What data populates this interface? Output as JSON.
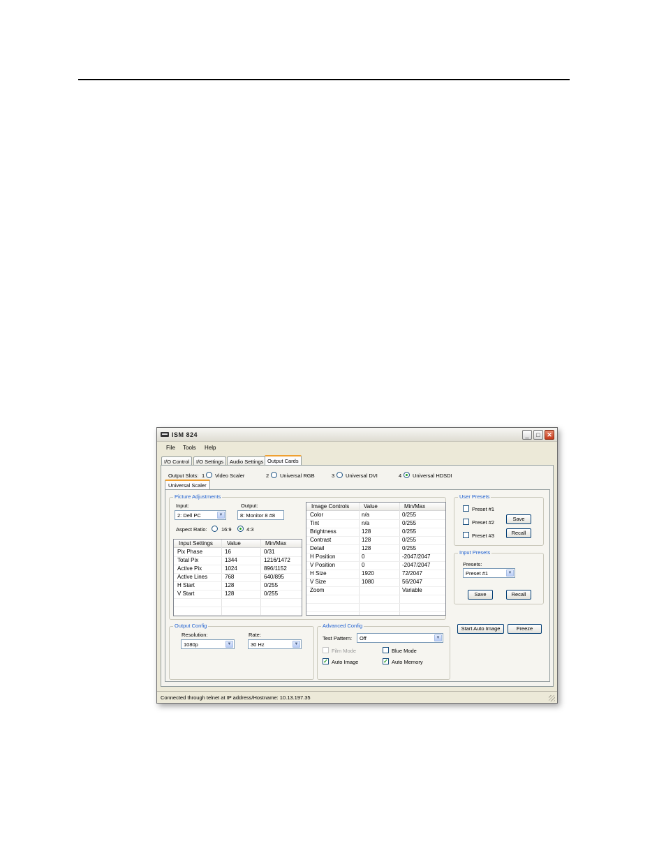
{
  "window": {
    "title": "ISM 824"
  },
  "menu": [
    "File",
    "Tools",
    "Help"
  ],
  "tabs": [
    "I/O Control",
    "I/O Settings",
    "Audio Settings",
    "Output Cards"
  ],
  "output_slots": {
    "label": "Output Slots:",
    "slots": [
      {
        "num": "1",
        "name": "Video Scaler",
        "selected": false
      },
      {
        "num": "2",
        "name": "Universal RGB",
        "selected": false
      },
      {
        "num": "3",
        "name": "Universal DVI",
        "selected": false
      },
      {
        "num": "4",
        "name": "Universal HDSDI",
        "selected": true
      }
    ]
  },
  "subtab": "Universal Scaler",
  "picture_adjustments": {
    "title": "Picture Adjustments",
    "input_label": "Input:",
    "input_value": "2: Dell PC",
    "output_label": "Output:",
    "output_value": "8: Monitor 8 #8",
    "aspect_label": "Aspect Ratio:",
    "aspect_16_9": "16:9",
    "aspect_4_3": "4:3",
    "aspect_selected": "4:3",
    "input_settings": {
      "headers": [
        "Input Settings",
        "Value",
        "Min/Max"
      ],
      "rows": [
        [
          "Pix Phase",
          "16",
          "0/31"
        ],
        [
          "Total Pix",
          "1344",
          "1216/1472"
        ],
        [
          "Active Pix",
          "1024",
          "896/1152"
        ],
        [
          "Active Lines",
          "768",
          "640/895"
        ],
        [
          "H Start",
          "128",
          "0/255"
        ],
        [
          "V Start",
          "128",
          "0/255"
        ]
      ]
    },
    "image_controls": {
      "headers": [
        "Image Controls",
        "Value",
        "Min/Max"
      ],
      "rows": [
        [
          "Color",
          "n/a",
          "0/255"
        ],
        [
          "Tint",
          "n/a",
          "0/255"
        ],
        [
          "Brightness",
          "128",
          "0/255"
        ],
        [
          "Contrast",
          "128",
          "0/255"
        ],
        [
          "Detail",
          "128",
          "0/255"
        ],
        [
          "H Position",
          "0",
          "-2047/2047"
        ],
        [
          "V Position",
          "0",
          "-2047/2047"
        ],
        [
          "H Size",
          "1920",
          "72/2047"
        ],
        [
          "V Size",
          "1080",
          "56/2047"
        ],
        [
          "Zoom",
          "",
          "Variable"
        ]
      ]
    }
  },
  "user_presets": {
    "title": "User Presets",
    "items": [
      "Preset #1",
      "Preset #2",
      "Preset #3"
    ],
    "save": "Save",
    "recall": "Recall"
  },
  "input_presets": {
    "title": "Input Presets",
    "presets_label": "Presets:",
    "presets_value": "Preset #1",
    "save": "Save",
    "recall": "Recall"
  },
  "buttons": {
    "start_auto_image": "Start Auto Image",
    "freeze": "Freeze"
  },
  "output_config": {
    "title": "Output Config",
    "resolution_label": "Resolution:",
    "resolution_value": "1080p",
    "rate_label": "Rate:",
    "rate_value": "30 Hz"
  },
  "advanced_config": {
    "title": "Advanced Config",
    "test_pattern_label": "Test Pattern:",
    "test_pattern_value": "Off",
    "film_mode": {
      "label": "Film Mode",
      "checked": false,
      "enabled": false
    },
    "blue_mode": {
      "label": "Blue Mode",
      "checked": false,
      "enabled": true
    },
    "auto_image": {
      "label": "Auto Image",
      "checked": true,
      "enabled": true
    },
    "auto_memory": {
      "label": "Auto Memory",
      "checked": true,
      "enabled": true
    }
  },
  "status": "Connected through telnet at IP address/Hostname: 10.13.197.35",
  "colors": {
    "group_title": "#1d5fd0",
    "tab_highlight": "#f0a030",
    "check_mark": "#21a121"
  }
}
